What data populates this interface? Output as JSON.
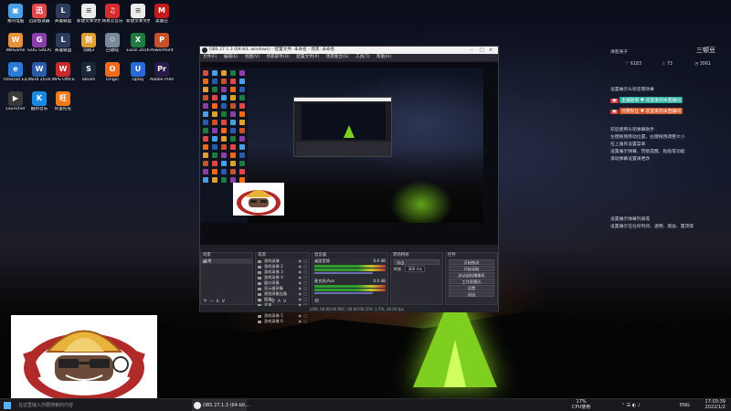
{
  "desktop": {
    "icons": [
      {
        "label": "我的电脑",
        "glyph": "▣",
        "color": "#4aa0e6"
      },
      {
        "label": "迅游加速器",
        "glyph": "迅",
        "color": "#e04848"
      },
      {
        "label": "英雄联盟",
        "glyph": "L",
        "color": "#2d3b5c"
      },
      {
        "label": "新建文本文档.txt",
        "glyph": "≡",
        "color": "#ececec"
      },
      {
        "label": "网易云音乐",
        "glyph": "♫",
        "color": "#d42d2d"
      },
      {
        "label": "新建文本文档.txt",
        "glyph": "≡",
        "color": "#ececec"
      },
      {
        "label": "黑曼巴",
        "glyph": "M",
        "color": "#c01a1a"
      },
      {
        "label": "WeGame",
        "glyph": "W",
        "color": "#e8903a"
      },
      {
        "label": "GOG GALAXY",
        "glyph": "G",
        "color": "#8a3fa8"
      },
      {
        "label": "英雄联盟",
        "glyph": "L",
        "color": "#2d3b5c"
      },
      {
        "label": "剑网3",
        "glyph": "剑",
        "color": "#e0a030"
      },
      {
        "label": "回收站",
        "glyph": "♲",
        "color": "#7a8a9a"
      },
      {
        "label": "Excel 2016",
        "glyph": "X",
        "color": "#1e7a40"
      },
      {
        "label": "PowerPoint",
        "glyph": "P",
        "color": "#c8502a"
      },
      {
        "label": "Internet Explorer",
        "glyph": "e",
        "color": "#2a7ad8"
      },
      {
        "label": "Word 2016",
        "glyph": "W",
        "color": "#2a5aa8"
      },
      {
        "label": "WPS Office",
        "glyph": "W",
        "color": "#c42a2a"
      },
      {
        "label": "Steam",
        "glyph": "S",
        "color": "#1b2838"
      },
      {
        "label": "Origin",
        "glyph": "O",
        "color": "#f06a1a"
      },
      {
        "label": "Uplay",
        "glyph": "U",
        "color": "#2a6ad8"
      },
      {
        "label": "Adobe Premiere",
        "glyph": "Pr",
        "color": "#2a1a48"
      },
      {
        "label": "Launcher",
        "glyph": "▶",
        "color": "#3a3a3a"
      },
      {
        "label": "酷狗音乐",
        "glyph": "K",
        "color": "#1a8ae0"
      },
      {
        "label": "阿里旺旺",
        "glyph": "旺",
        "color": "#f07a1a"
      }
    ]
  },
  "obs": {
    "title": "OBS 27.1.3 (64-bit, windows) - 配置文件: 未命名 - 场景: 未命名",
    "menu": [
      "文件(F)",
      "编辑(E)",
      "视图(V)",
      "停靠部件(D)",
      "配置文件(P)",
      "场景集合(S)",
      "工具(T)",
      "帮助(H)"
    ],
    "docks": {
      "scenes": {
        "title": "场景",
        "items": [
          "场景"
        ]
      },
      "sources": {
        "title": "来源",
        "items": [
          "游戏录像",
          "游戏录像 2",
          "游戏录像 3",
          "游戏录像 4",
          "窗口采集",
          "显示器采集",
          "视频采集设备",
          "图像",
          "文本",
          "媒体源",
          "游戏录像 5",
          "游戏录像 6"
        ]
      },
      "mixer": {
        "title": "混音器",
        "channels": [
          "桌面音频",
          "麦克风/Aux"
        ],
        "levels": [
          "0.0 dB",
          "0.0 dB"
        ]
      },
      "transitions": {
        "title": "转场特效",
        "type": "淡出",
        "duration_label": "时长",
        "duration": "300 ms"
      },
      "controls": {
        "title": "控件",
        "buttons": [
          "开始推流",
          "开始录制",
          "启动虚拟摄像机",
          "工作室模式",
          "设置",
          "退出"
        ]
      }
    },
    "status": "LIVE: 00:00:00   REC: 00:00:00   CPU: 1.5%, 30.00 fps"
  },
  "widget": {
    "name": "清客壳子",
    "user": "三顿豆",
    "stats": [
      "♡ 6183",
      "☆ 73",
      "◷ 3061"
    ],
    "lines": [
      "设置展示头衔逆袭效果",
      "主播勋章 ♥ 欢迎来到本直播间",
      "付费粉丝 ♥ 欢迎来到本直播间",
      "欢迎使用头衔弹幕助手",
      "左键拖拽移动位置，右键拖拽调整大小",
      "在上角有设置菜单",
      "设置展示弹幕、赞助提醒、粘贴等功能",
      "滚动弹幕设置请更改",
      "设置展示弹幕列表等",
      "设置展示在任何时间、透明、底层、置顶等"
    ]
  },
  "taskbar": {
    "search": "在这里输入你要搜索的内容",
    "task_label": "OBS 27.1.3 (64-bit...",
    "cpu": "17%",
    "cpu_label": "CPU使用",
    "lang": "ENG",
    "time": "17:03:39",
    "date": "2022/1/2"
  }
}
